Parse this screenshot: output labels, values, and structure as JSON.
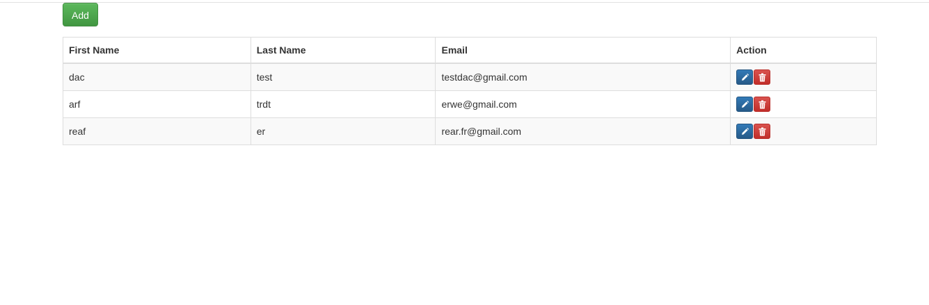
{
  "toolbar": {
    "add_label": "Add"
  },
  "table": {
    "headers": [
      "First Name",
      "Last Name",
      "Email",
      "Action"
    ],
    "rows": [
      {
        "first_name": "dac",
        "last_name": "test",
        "email": "testdac@gmail.com"
      },
      {
        "first_name": "arf",
        "last_name": "trdt",
        "email": "erwe@gmail.com"
      },
      {
        "first_name": "reaf",
        "last_name": "er",
        "email": "rear.fr@gmail.com"
      }
    ],
    "row_actions": [
      {
        "name": "edit",
        "icon": "pencil-icon",
        "color": "#337ab7"
      },
      {
        "name": "delete",
        "icon": "trash-icon",
        "color": "#d9534f"
      }
    ]
  },
  "colors": {
    "add_button": "#5cb85c",
    "edit_button": "#337ab7",
    "delete_button": "#d9534f",
    "stripe": "#f9f9f9",
    "border": "#dddddd"
  }
}
